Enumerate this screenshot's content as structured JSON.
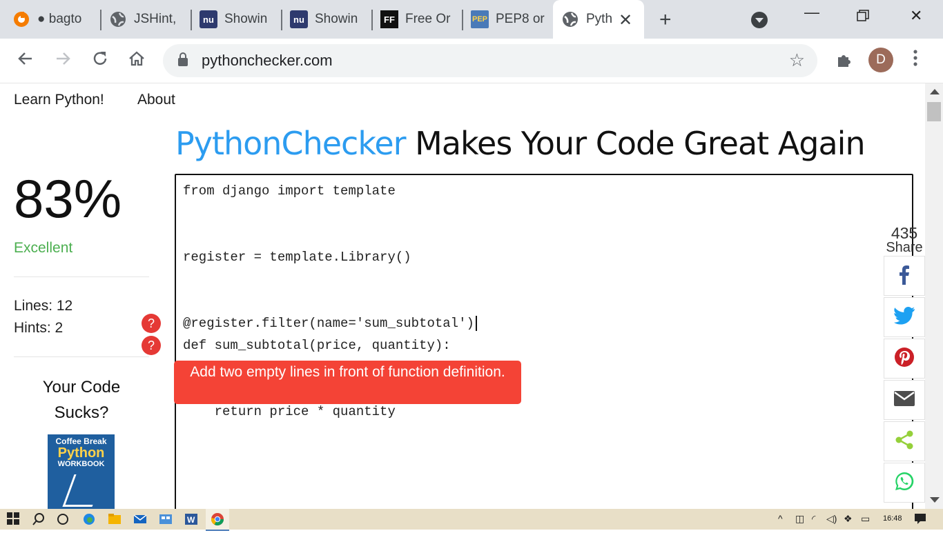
{
  "browser": {
    "tabs": [
      {
        "label": "● bagto",
        "icon": "gitlab-icon",
        "active": false
      },
      {
        "label": "JSHint,",
        "icon": "globe-icon",
        "active": false
      },
      {
        "label": "Showin",
        "icon": "nu-validator-icon",
        "active": false
      },
      {
        "label": "Showin",
        "icon": "nu-validator-icon",
        "active": false
      },
      {
        "label": "Free Or",
        "icon": "freeformatter-icon",
        "active": false
      },
      {
        "label": "PEP8 or",
        "icon": "pep8-icon",
        "active": false
      },
      {
        "label": "Pyth",
        "icon": "globe-icon",
        "active": true
      }
    ],
    "url": "pythonchecker.com",
    "profile_initial": "D"
  },
  "page": {
    "nav": [
      "Learn Python!",
      "About"
    ],
    "headline_brand": "PythonChecker",
    "headline_rest": " Makes Your Code Great Again",
    "score": "83%",
    "verdict": "Excellent",
    "lines_stat": "Lines: 12",
    "hints_stat": "Hints: 2",
    "hint_badge_1": "?",
    "hint_badge_2": "?",
    "promo_line1": "Your Code",
    "promo_line2": "Sucks?",
    "book": {
      "line1": "Coffee Break",
      "line2": "Python",
      "line3": "WORKBOOK"
    },
    "code_lines": [
      "from django import template",
      "",
      "",
      "register = template.Library()",
      "",
      "",
      "@register.filter(name='sum_subtotal')",
      "def sum_subtotal(price, quantity):",
      "",
      "",
      "    return price * quantity"
    ],
    "tooltip": "Add two empty lines in front of function definition."
  },
  "share": {
    "count": "435",
    "label": "Share",
    "buttons": [
      {
        "name": "facebook",
        "color": "#3b5998"
      },
      {
        "name": "twitter",
        "color": "#1da1f2"
      },
      {
        "name": "pinterest",
        "color": "#cb2027"
      },
      {
        "name": "email",
        "color": "#4d4d4d"
      },
      {
        "name": "sharethis",
        "color": "#95d03a"
      },
      {
        "name": "whatsapp",
        "color": "#25d366"
      }
    ]
  },
  "taskbar": {
    "time": "16:48"
  },
  "colors": {
    "brand_blue": "#2c9cf0",
    "excellent_green": "#4caf50",
    "hint_red": "#e53935",
    "tooltip_red": "#f44336"
  }
}
